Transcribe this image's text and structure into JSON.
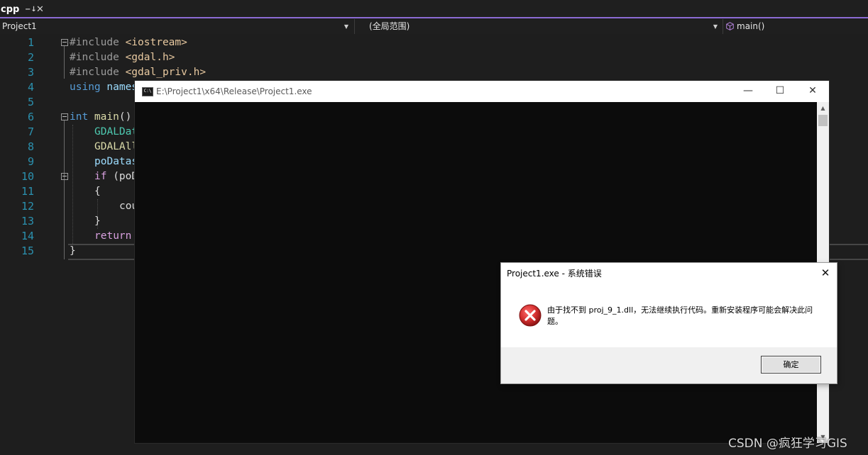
{
  "tab": {
    "label": "cpp",
    "pin_glyph": "−↓",
    "close_glyph": "✕"
  },
  "navbar": {
    "project": "Project1",
    "scope": "(全局范围)",
    "function": "main()"
  },
  "code": {
    "lines": [
      {
        "num": "1",
        "pre": "#include ",
        "str": "<iostream>"
      },
      {
        "num": "2",
        "pre": "#include ",
        "str": "<gdal.h>"
      },
      {
        "num": "3",
        "pre": "#include ",
        "str": "<gdal_priv.h>"
      },
      {
        "num": "4",
        "kw": "using",
        "rest": " names"
      },
      {
        "num": "5"
      },
      {
        "num": "6",
        "kw": "int",
        "fn": " main",
        "rest": "()"
      },
      {
        "num": "7",
        "ty": "GDALDat"
      },
      {
        "num": "8",
        "fn": "GDALAll"
      },
      {
        "num": "9",
        "var": "poDatas"
      },
      {
        "num": "10",
        "ctl": "if",
        "rest": " (poD"
      },
      {
        "num": "11",
        "rest": "{"
      },
      {
        "num": "12",
        "rest": "cou"
      },
      {
        "num": "13",
        "rest": "}"
      },
      {
        "num": "14",
        "ctl": "return"
      },
      {
        "num": "15",
        "rest": "}"
      }
    ]
  },
  "console": {
    "title": "E:\\Project1\\x64\\Release\\Project1.exe",
    "icon_text": "C:\\",
    "minimize": "—",
    "maximize": "☐",
    "close": "✕"
  },
  "dialog": {
    "title": "Project1.exe - 系统错误",
    "close": "✕",
    "message": "由于找不到 proj_9_1.dll，无法继续执行代码。重新安装程序可能会解决此问题。",
    "ok": "确定"
  },
  "watermark": "CSDN @疯狂学习GIS",
  "colors": {
    "accent": "#8b6bd4",
    "line_number": "#2b91af",
    "error_red": "#c62828"
  }
}
